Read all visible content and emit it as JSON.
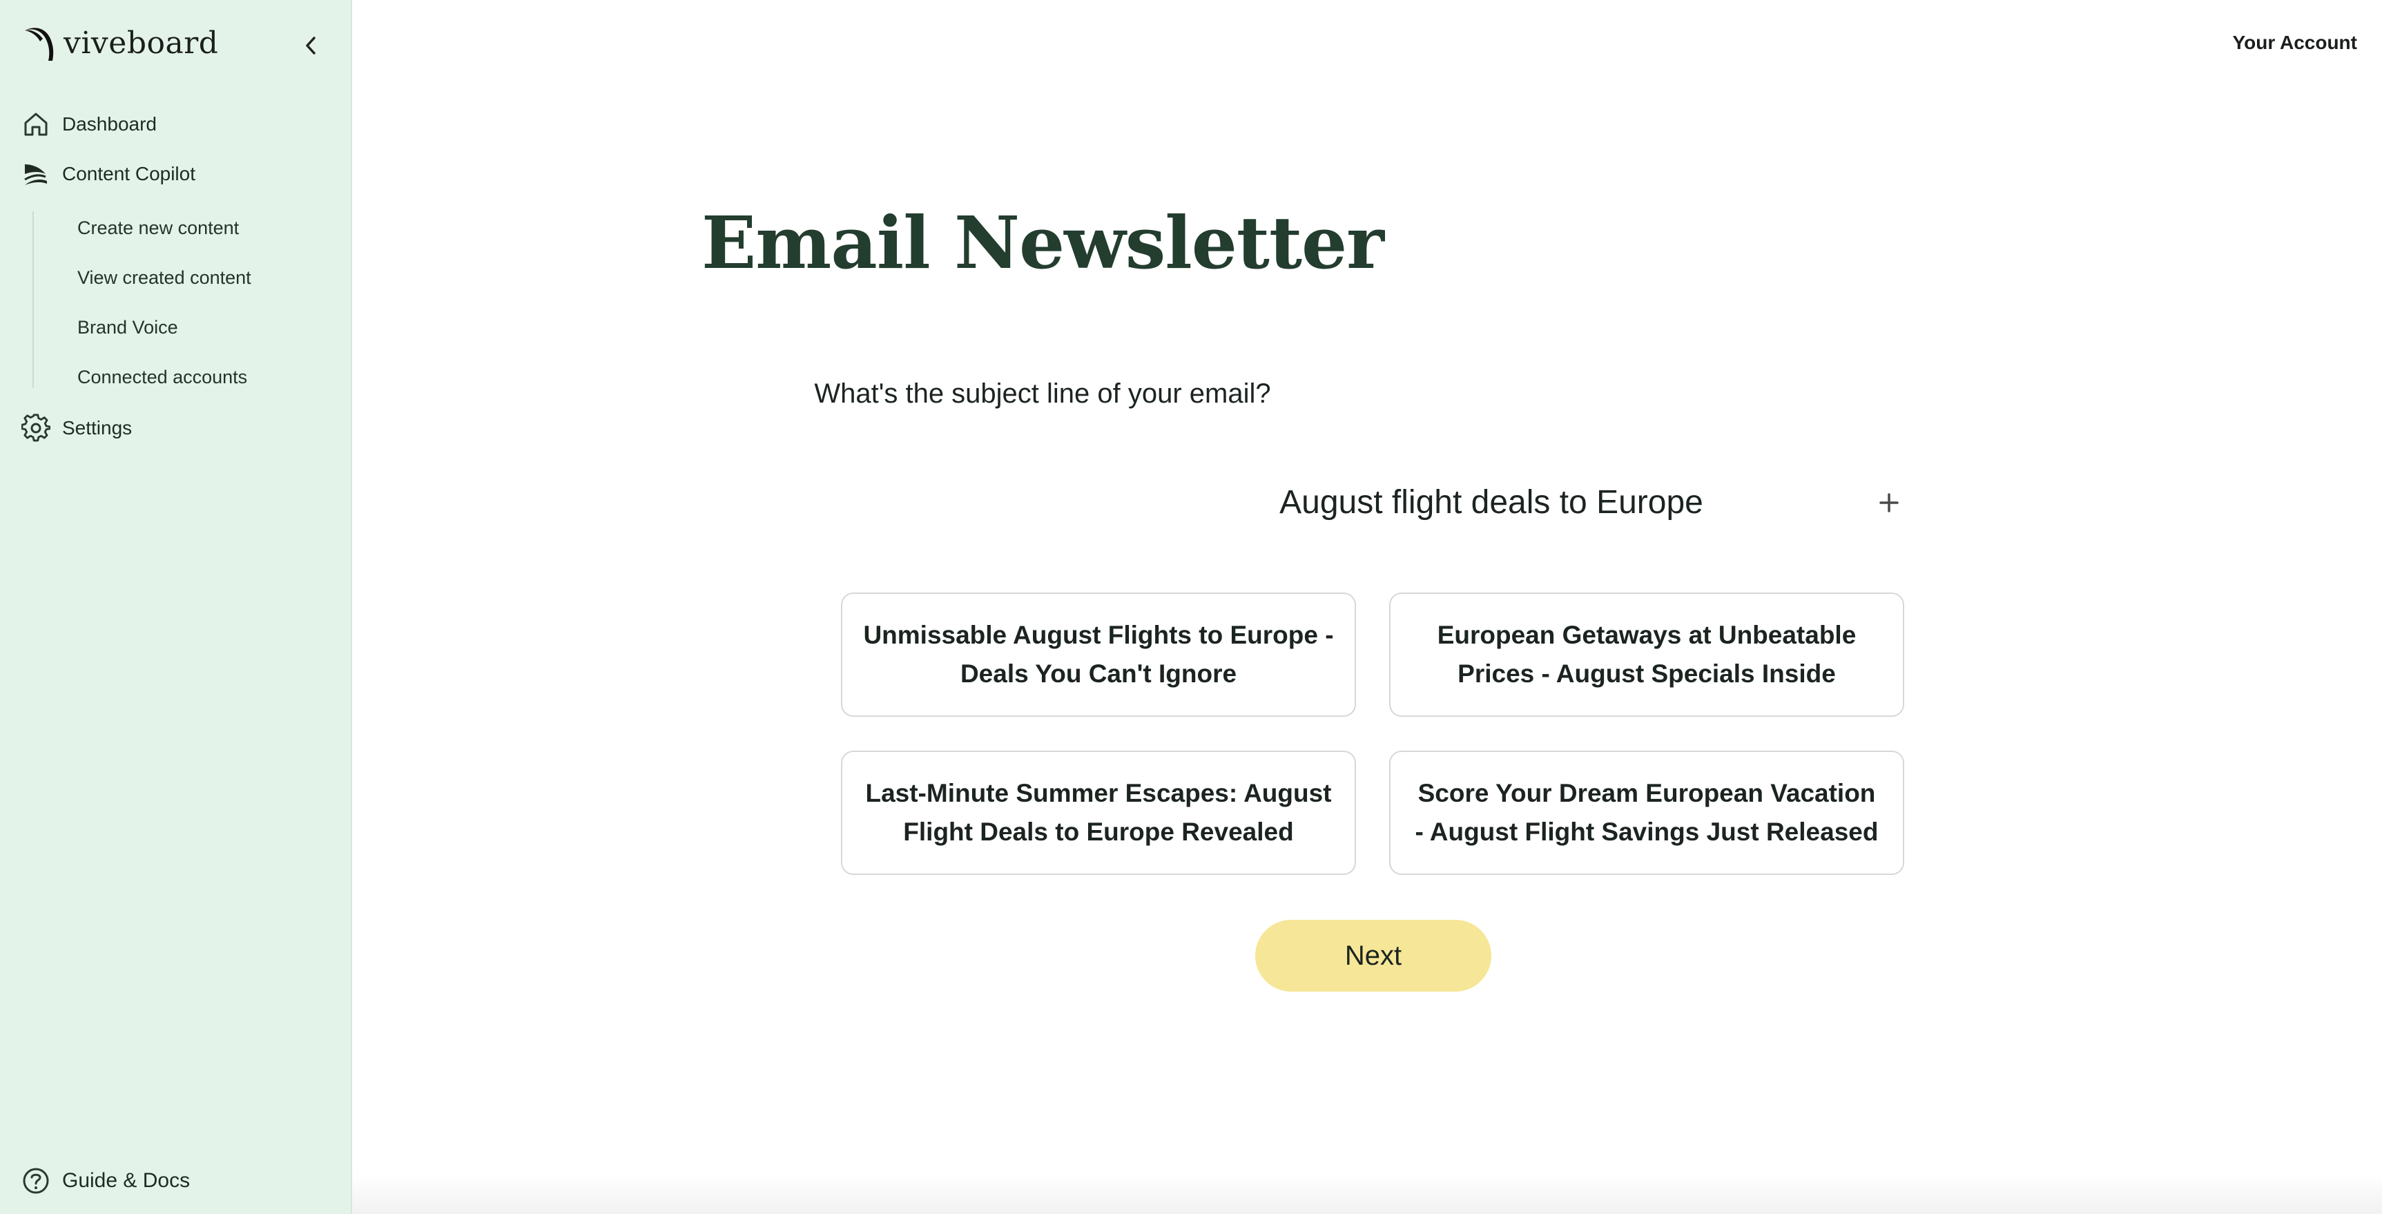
{
  "app": {
    "name": "viveboard"
  },
  "header": {
    "account_label": "Your Account"
  },
  "sidebar": {
    "items": [
      {
        "label": "Dashboard",
        "icon": "home-icon"
      },
      {
        "label": "Content Copilot",
        "icon": "copilot-icon"
      },
      {
        "label": "Settings",
        "icon": "gear-icon"
      }
    ],
    "sub_items": [
      {
        "label": "Create new content"
      },
      {
        "label": "View created content"
      },
      {
        "label": "Brand Voice"
      },
      {
        "label": "Connected accounts"
      }
    ],
    "footer": {
      "label": "Guide & Docs",
      "icon": "help-circle-icon"
    }
  },
  "main": {
    "title": "Email Newsletter",
    "question": "What's the subject line of your email?",
    "subject_value": "August flight deals to Europe",
    "suggestions": [
      {
        "text": "Unmissable August Flights to Europe - Deals You Can't Ignore"
      },
      {
        "text": "European Getaways at Unbeatable Prices - August Specials Inside"
      },
      {
        "text": "Last-Minute Summer Escapes: August Flight Deals to Europe Revealed"
      },
      {
        "text": "Score Your Dream European Vacation - August Flight Savings Just Released"
      }
    ],
    "next_label": "Next"
  },
  "colors": {
    "sidebar_bg": "#e4f3ea",
    "title": "#233d2f",
    "next_button": "#f6e697",
    "card_border": "#d6d8d7"
  }
}
